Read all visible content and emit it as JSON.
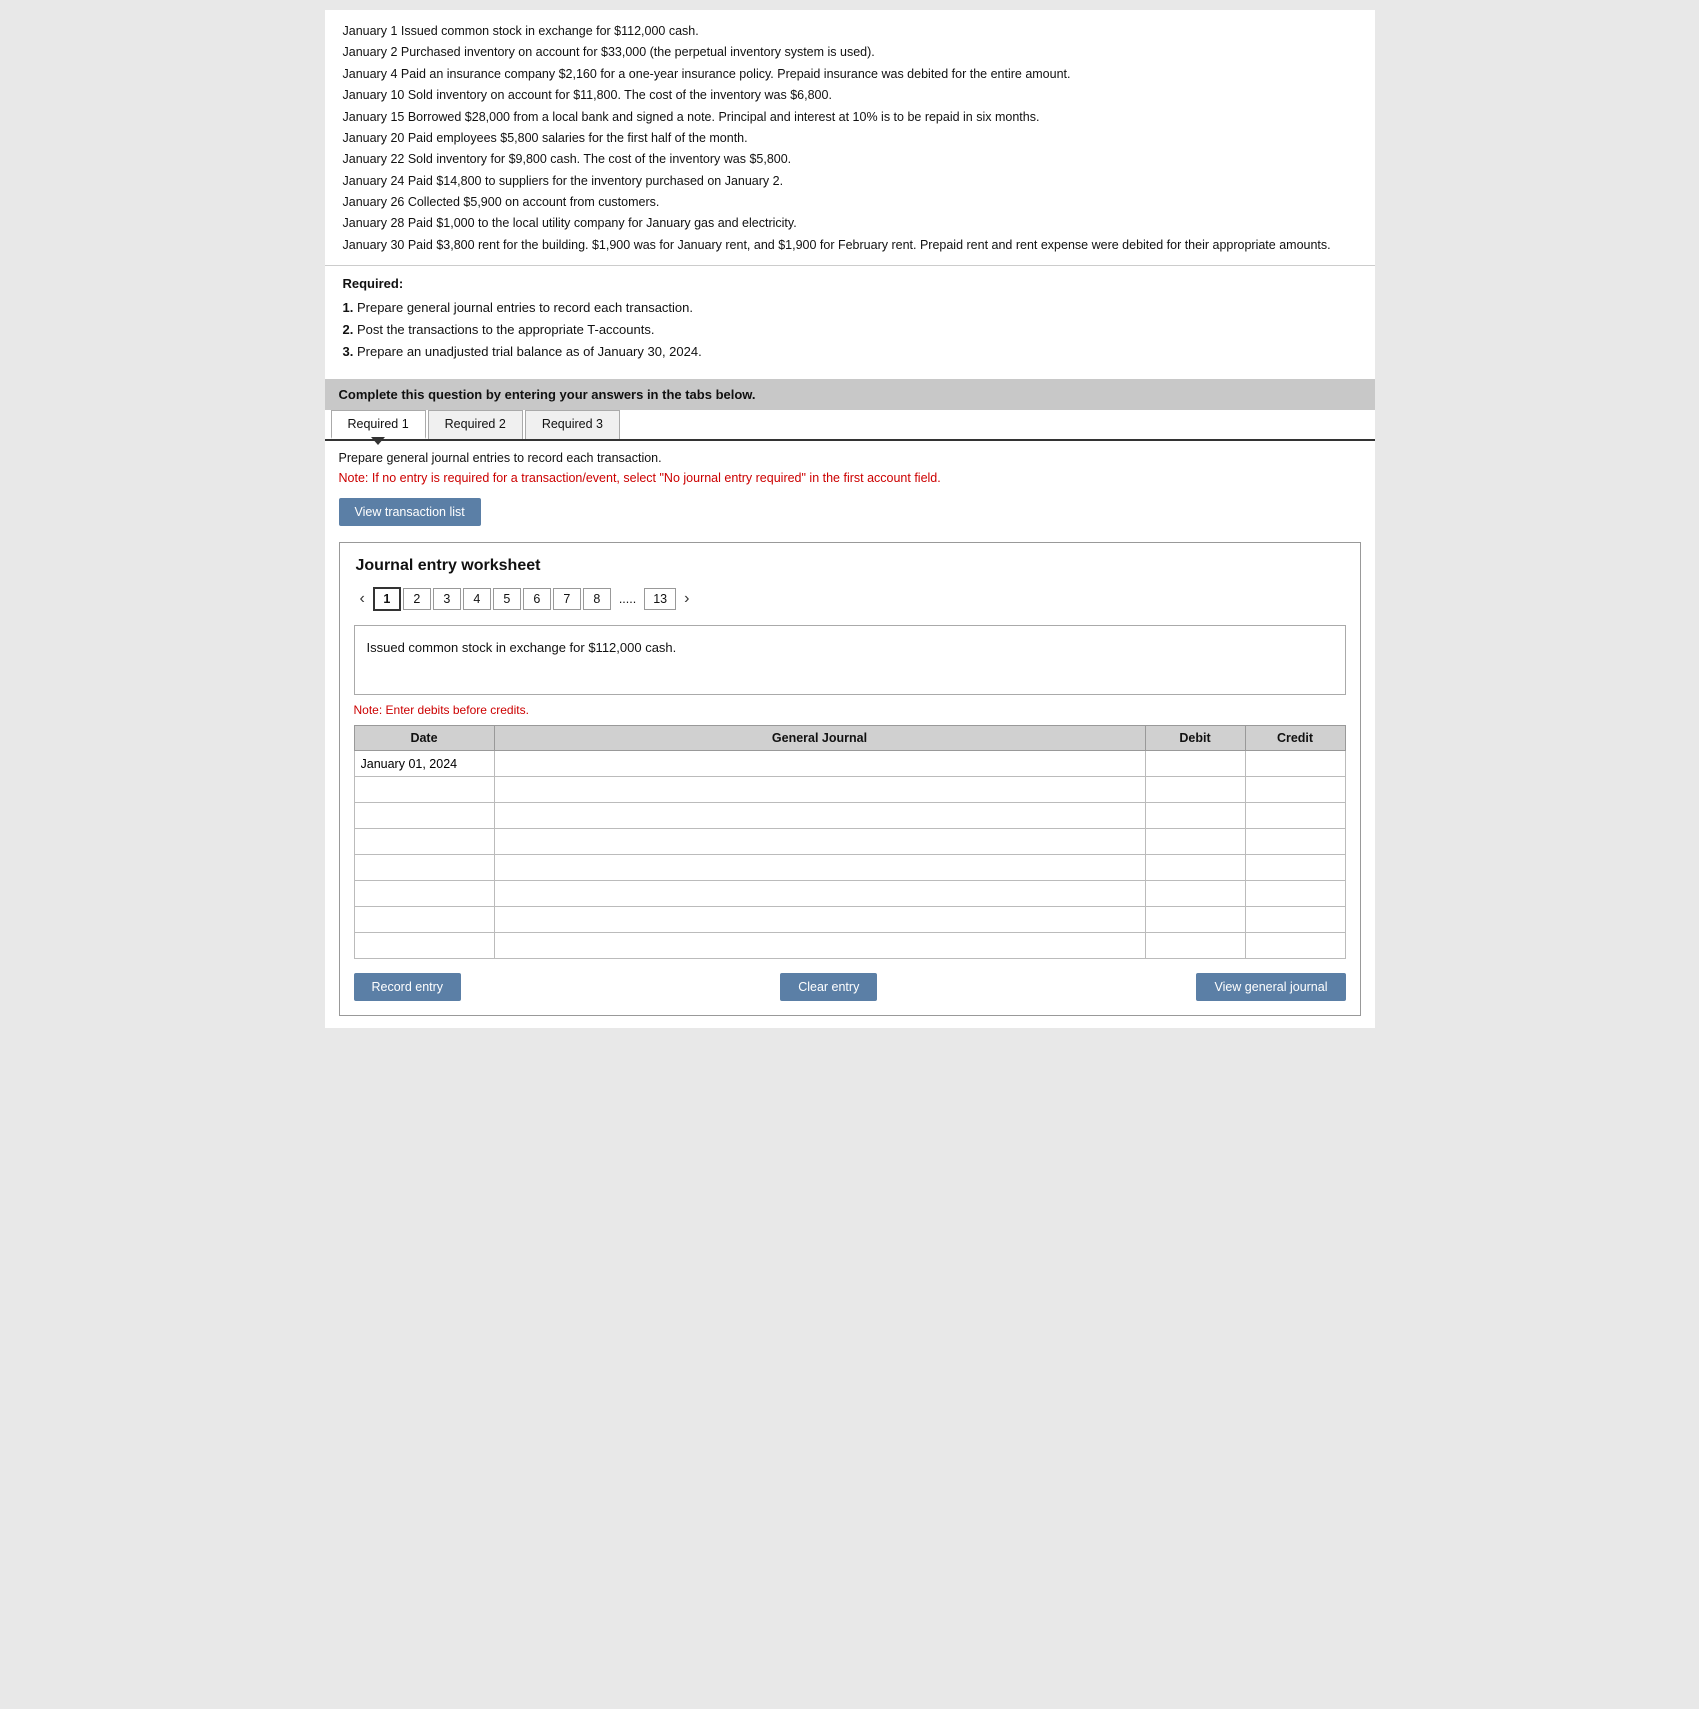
{
  "transactions": {
    "items": [
      {
        "date": "January 1",
        "text": "Issued common stock in exchange for $112,000 cash."
      },
      {
        "date": "January 2",
        "text": "Purchased inventory on account for $33,000 (the perpetual inventory system is used)."
      },
      {
        "date": "January 4",
        "text": "Paid an insurance company $2,160 for a one-year insurance policy. Prepaid insurance was debited for the entire amount."
      },
      {
        "date": "January 10",
        "text": "Sold inventory on account for $11,800. The cost of the inventory was $6,800."
      },
      {
        "date": "January 15",
        "text": "Borrowed $28,000 from a local bank and signed a note. Principal and interest at 10% is to be repaid in six months."
      },
      {
        "date": "January 20",
        "text": "Paid employees $5,800 salaries for the first half of the month."
      },
      {
        "date": "January 22",
        "text": "Sold inventory for $9,800 cash. The cost of the inventory was $5,800."
      },
      {
        "date": "January 24",
        "text": "Paid $14,800 to suppliers for the inventory purchased on January 2."
      },
      {
        "date": "January 26",
        "text": "Collected $5,900 on account from customers."
      },
      {
        "date": "January 28",
        "text": "Paid $1,000 to the local utility company for January gas and electricity."
      },
      {
        "date": "January 30",
        "text": "Paid $3,800 rent for the building. $1,900 was for January rent, and $1,900 for February rent. Prepaid rent and rent expense were debited for their appropriate amounts."
      }
    ]
  },
  "required": {
    "title": "Required:",
    "items": [
      {
        "num": "1.",
        "text": "Prepare general journal entries to record each transaction."
      },
      {
        "num": "2.",
        "text": "Post the transactions to the appropriate T-accounts."
      },
      {
        "num": "3.",
        "text": "Prepare an unadjusted trial balance as of January 30, 2024."
      }
    ]
  },
  "instruction_bar": {
    "text": "Complete this question by entering your answers in the tabs below."
  },
  "tabs": [
    {
      "id": "req1",
      "label": "Required 1",
      "active": true
    },
    {
      "id": "req2",
      "label": "Required 2",
      "active": false
    },
    {
      "id": "req3",
      "label": "Required 3",
      "active": false
    }
  ],
  "tab_instructions": {
    "main": "Prepare general journal entries to record each transaction.",
    "note": "Note: If no entry is required for a transaction/event, select \"No journal entry required\" in the first account field."
  },
  "view_transaction_btn": "View transaction list",
  "worksheet": {
    "title": "Journal entry worksheet",
    "pages": [
      "1",
      "2",
      "3",
      "4",
      "5",
      "6",
      "7",
      "8",
      ".....",
      "13"
    ],
    "active_page": "1",
    "description": "Issued common stock in exchange for $112,000 cash.",
    "note_debits": "Note: Enter debits before credits.",
    "table": {
      "headers": [
        "Date",
        "General Journal",
        "Debit",
        "Credit"
      ],
      "rows": [
        {
          "date": "January 01, 2024",
          "journal": "",
          "debit": "",
          "credit": ""
        },
        {
          "date": "",
          "journal": "",
          "debit": "",
          "credit": ""
        },
        {
          "date": "",
          "journal": "",
          "debit": "",
          "credit": ""
        },
        {
          "date": "",
          "journal": "",
          "debit": "",
          "credit": ""
        },
        {
          "date": "",
          "journal": "",
          "debit": "",
          "credit": ""
        },
        {
          "date": "",
          "journal": "",
          "debit": "",
          "credit": ""
        },
        {
          "date": "",
          "journal": "",
          "debit": "",
          "credit": ""
        },
        {
          "date": "",
          "journal": "",
          "debit": "",
          "credit": ""
        }
      ]
    },
    "buttons": {
      "record": "Record entry",
      "clear": "Clear entry",
      "view_journal": "View general journal"
    }
  }
}
